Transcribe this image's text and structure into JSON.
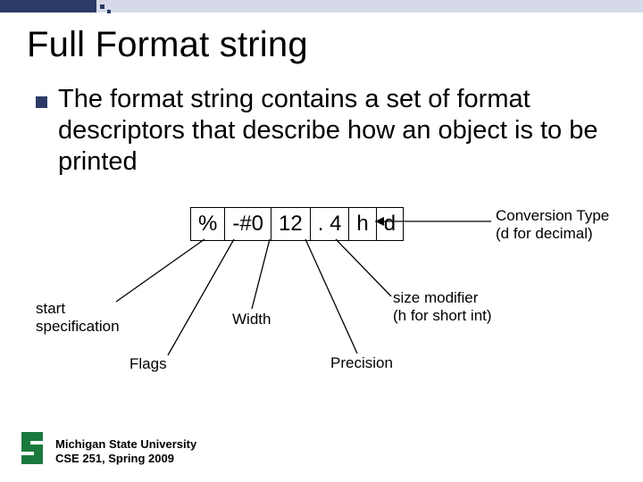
{
  "title": "Full Format string",
  "body": "The format string contains a set of format descriptors that describe how an object is to be printed",
  "format_cells": {
    "c0": "%",
    "c1": "-#0",
    "c2": "12",
    "c3": ". 4",
    "c4": "h",
    "c5": "d"
  },
  "labels": {
    "start": "start specification",
    "flags": "Flags",
    "width": "Width",
    "precision": "Precision",
    "size": "size modifier\n(h for short int)",
    "conversion": "Conversion Type\n(d for decimal)"
  },
  "footer": {
    "line1": "Michigan State University",
    "line2": "CSE 251, Spring 2009"
  }
}
